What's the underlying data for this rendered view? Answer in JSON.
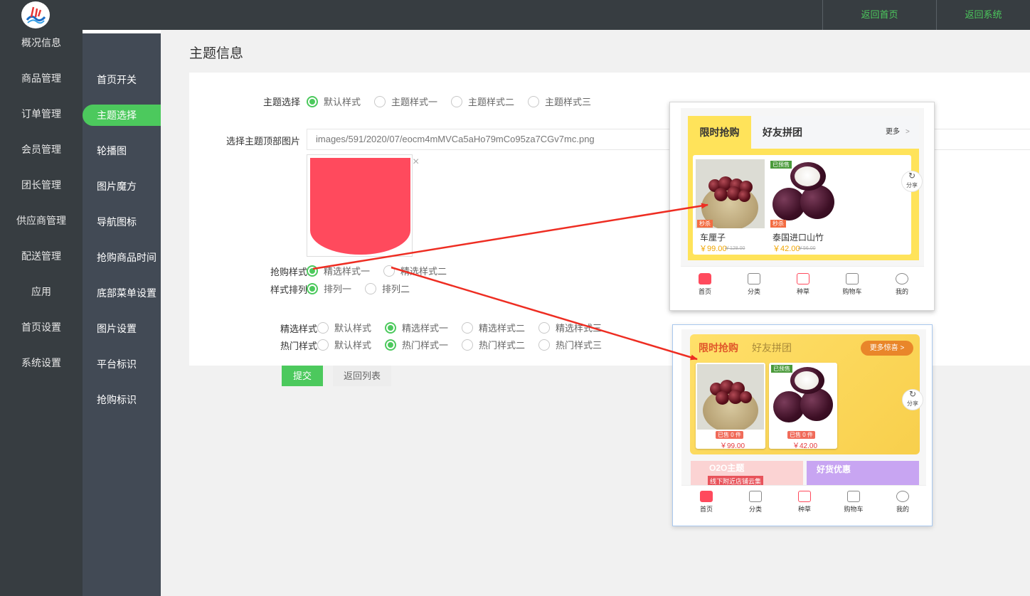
{
  "topbar": {
    "home_link": "返回首页",
    "system_link": "返回系统"
  },
  "sidebar_primary": [
    "概况信息",
    "商品管理",
    "订单管理",
    "会员管理",
    "团长管理",
    "供应商管理",
    "配送管理",
    "应用",
    "首页设置",
    "系统设置"
  ],
  "sidebar_secondary": [
    "首页开关",
    "主题选择",
    "轮播图",
    "图片魔方",
    "导航图标",
    "抢购商品时间",
    "底部菜单设置",
    "图片设置",
    "平台标识",
    "抢购标识"
  ],
  "page_title": "主题信息",
  "form": {
    "theme_label": "主题选择",
    "theme_options": [
      "默认样式",
      "主题样式一",
      "主题样式二",
      "主题样式三"
    ],
    "header_image_label": "选择主题顶部图片",
    "header_image_path": "images/591/2020/07/eocm4mMVCa5aHo79mCo95za7CGv7mc.png",
    "close_glyph": "×",
    "flash_style_label": "抢购样式",
    "flash_style_options": [
      "精选样式一",
      "精选样式二"
    ],
    "layout_label": "样式排列",
    "layout_options": [
      "排列一",
      "排列二"
    ],
    "featured_label": "精选样式",
    "featured_options": [
      "默认样式",
      "精选样式一",
      "精选样式二",
      "精选样式三"
    ],
    "hot_label": "热门样式",
    "hot_options": [
      "默认样式",
      "热门样式一",
      "热门样式二",
      "热门样式三"
    ],
    "submit_label": "提交",
    "back_label": "返回列表"
  },
  "preview1": {
    "tab_flash": "限时抢购",
    "tab_group": "好友拼团",
    "more": "更多",
    "chevron": ">",
    "share": "分享",
    "products": [
      {
        "name": "车厘子",
        "price": "￥99.00",
        "old_price": "￥128.00",
        "tag": "秒杀"
      },
      {
        "name": "泰国进口山竹",
        "price": "￥42.00",
        "old_price": "￥56.00",
        "tag": "秒杀",
        "badge": "已预售"
      }
    ],
    "nav": [
      "首页",
      "分类",
      "种草",
      "购物车",
      "我的"
    ]
  },
  "preview2": {
    "tab_flash": "限时抢购",
    "tab_group": "好友拼团",
    "more": "更多惊喜 >",
    "share": "分享",
    "products": [
      {
        "sold": "已售 0 件",
        "price": "￥99.00"
      },
      {
        "sold": "已售 0 件",
        "price": "￥42.00",
        "badge": "已预售"
      }
    ],
    "banner_o2o_title": "O2O主题",
    "banner_o2o_sub": "线下附近店铺云集",
    "banner_goods_title": "好货优惠",
    "nav": [
      "首页",
      "分类",
      "种草",
      "购物车",
      "我的"
    ]
  },
  "colors": {
    "accent": "#4cc95d",
    "dark_bar": "#373d41",
    "sidebar2": "#424a55",
    "arrow": "#ee2d22",
    "theme_red": "#ff4a5d"
  }
}
